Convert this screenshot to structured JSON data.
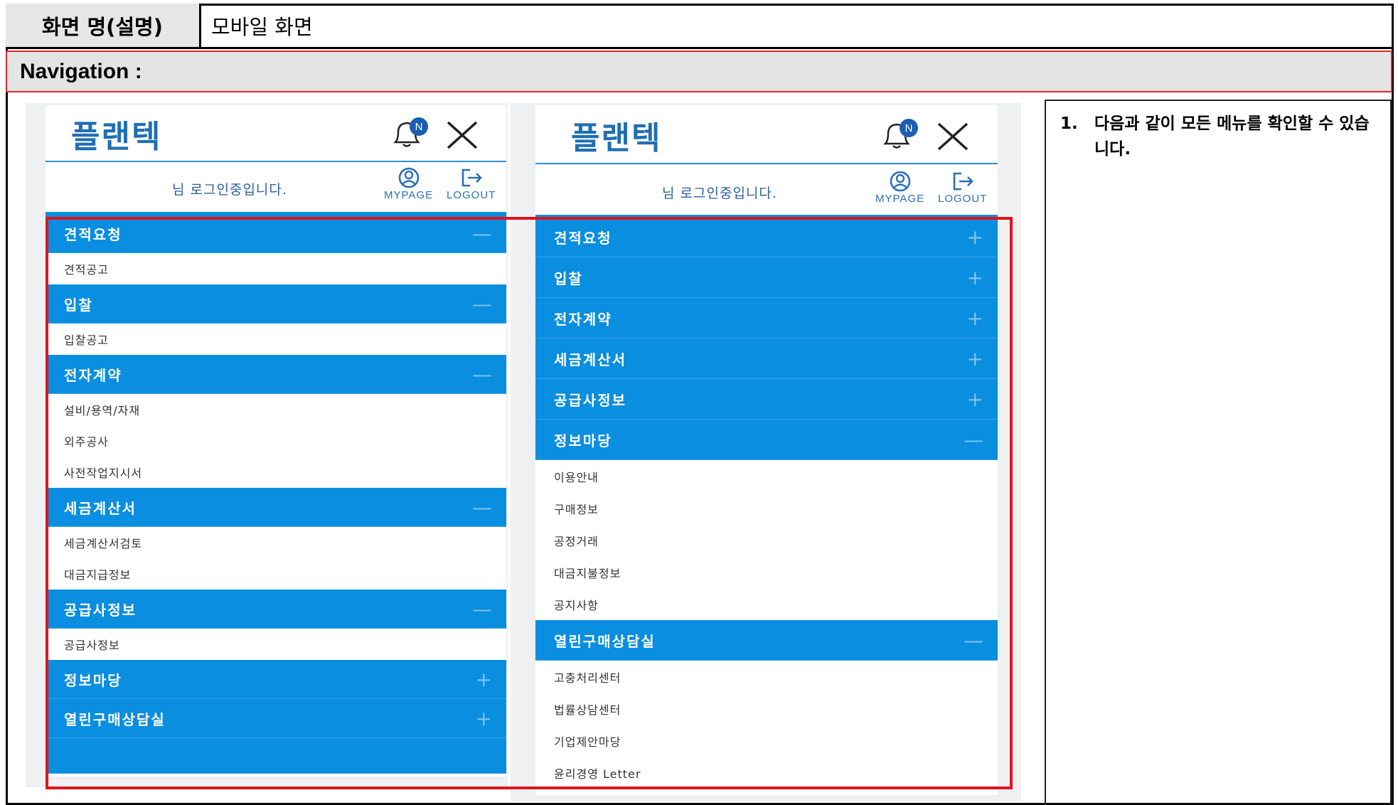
{
  "header": {
    "label": "화면 명(설명)",
    "value": "모바일 화면"
  },
  "section": {
    "title": "Navigation :"
  },
  "note": {
    "num": "1.",
    "text": "다음과 같이 모든 메뉴를 확인할 수 있습니다."
  },
  "left_phone": {
    "logo": "플랜텍",
    "badge": "N",
    "user_msg": "님 로그인중입니다.",
    "mypage": "MYPAGE",
    "logout": "LOGOUT",
    "menus": [
      {
        "title": "견적요청",
        "sign": "—",
        "subs": [
          "견적공고"
        ]
      },
      {
        "title": "입찰",
        "sign": "—",
        "subs": [
          "입찰공고"
        ]
      },
      {
        "title": "전자계약",
        "sign": "—",
        "subs": [
          "설비/용역/자재",
          "외주공사",
          "사전작업지시서"
        ]
      },
      {
        "title": "세금계산서",
        "sign": "—",
        "subs": [
          "세금계산서검토",
          "대금지급정보"
        ]
      },
      {
        "title": "공급사정보",
        "sign": "—",
        "subs": [
          "공급사정보"
        ]
      },
      {
        "title": "정보마당",
        "sign": "+",
        "subs": []
      },
      {
        "title": "열린구매상담실",
        "sign": "+",
        "subs": []
      }
    ]
  },
  "right_phone": {
    "logo": "플랜텍",
    "badge": "N",
    "user_msg": "님 로그인중입니다.",
    "mypage": "MYPAGE",
    "logout": "LOGOUT",
    "menus": [
      {
        "title": "견적요청",
        "sign": "+",
        "subs": []
      },
      {
        "title": "입찰",
        "sign": "+",
        "subs": []
      },
      {
        "title": "전자계약",
        "sign": "+",
        "subs": []
      },
      {
        "title": "세금계산서",
        "sign": "+",
        "subs": []
      },
      {
        "title": "공급사정보",
        "sign": "+",
        "subs": []
      },
      {
        "title": "정보마당",
        "sign": "—",
        "subs": [
          "이용안내",
          "구매정보",
          "공정거래",
          "대금지불정보",
          "공지사항"
        ]
      },
      {
        "title": "열린구매상담실",
        "sign": "—",
        "subs": [
          "고충처리센터",
          "법률상담센터",
          "기업제안마당",
          "윤리경영 Letter"
        ]
      }
    ]
  }
}
